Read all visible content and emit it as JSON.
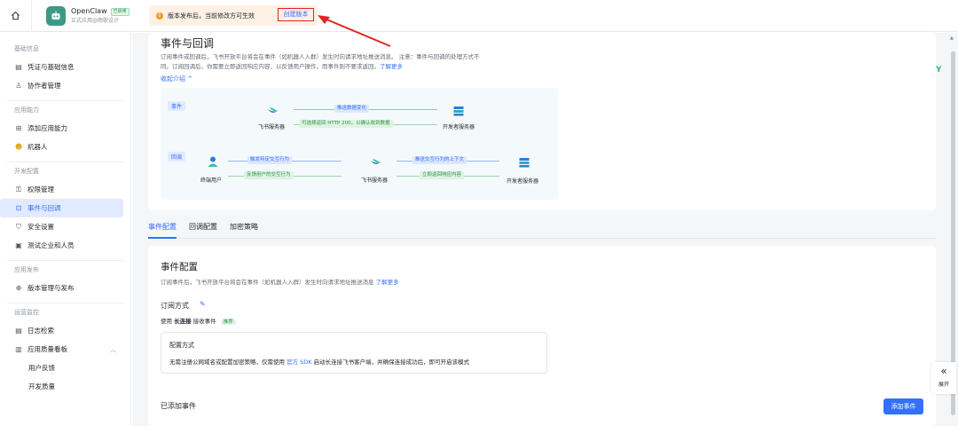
{
  "topbar": {
    "app_name": "OpenClaw",
    "enabled_badge": "已启用",
    "app_sub": "正式应用@雨歌设计",
    "notice_text": "版本发布后，当前修改方可生效",
    "create_version": "创建版本"
  },
  "sidebar": {
    "sections": [
      {
        "title": "基础信息",
        "items": [
          {
            "label": "凭证与基础信息",
            "icon": "credential-icon"
          },
          {
            "label": "协作者管理",
            "icon": "user-icon"
          }
        ]
      },
      {
        "title": "应用能力",
        "items": [
          {
            "label": "添加应用能力",
            "icon": "grid-add-icon"
          },
          {
            "label": "机器人",
            "icon": "robot-icon"
          }
        ]
      },
      {
        "title": "开发配置",
        "items": [
          {
            "label": "权限管理",
            "icon": "lock-icon"
          },
          {
            "label": "事件与回调",
            "icon": "event-icon",
            "active": true
          },
          {
            "label": "安全设置",
            "icon": "shield-icon"
          },
          {
            "label": "测试企业和人员",
            "icon": "test-icon"
          }
        ]
      },
      {
        "title": "应用发布",
        "items": [
          {
            "label": "版本管理与发布",
            "icon": "version-icon"
          }
        ]
      },
      {
        "title": "运营监控",
        "items": [
          {
            "label": "日志检索",
            "icon": "log-icon"
          },
          {
            "label": "应用质量看板",
            "icon": "chart-icon"
          }
        ]
      }
    ],
    "sub_items": [
      "用户反馈",
      "开发质量"
    ]
  },
  "card1": {
    "title": "事件与回调",
    "desc1": "订阅事件或回调后，飞书开放平台将会在事件（如机器人入群）发生时向请求地址推送消息。 注意：事件与回调的处理方式不",
    "desc2": "同。订阅回调后，你需要立即返回响应内容，以反馈用户操作，而事件则不要求返回。",
    "learn_more": "了解更多",
    "collapse": "收起介绍 ^",
    "diagram": {
      "event_tag": "事件",
      "callback_tag": "回调",
      "feishu_server": "飞书服务器",
      "dev_server": "开发者服务器",
      "end_user": "终端用户",
      "push_data": "推送数据变化",
      "http_ok": "可选择返回 HTTP 200，以确认收到数据",
      "trigger": "触发特定交互行为",
      "feedback": "反馈用户的交互行为",
      "push_ctx": "推送交互行为的上下文",
      "return_resp": "立即返回响应内容"
    }
  },
  "tabs": [
    "事件配置",
    "回调配置",
    "加密策略"
  ],
  "card2": {
    "title": "事件配置",
    "desc": "订阅事件后，飞书开放平台将会在事件（如机器人入群）发生时向请求地址推送消息",
    "learn_more": "了解更多",
    "sub_title": "订阅方式",
    "use_prefix": "使用",
    "use_bold": "长连接",
    "use_suffix": "接收事件",
    "recommend": "推荐",
    "cfg_title": "配置方式",
    "cfg_text_a": "无需注册公网域名或配置加密策略，仅需使用",
    "cfg_link": "官方 SDK",
    "cfg_text_b": "启动长连接飞书客户端，并确保连接成功后，即可开启该模式",
    "added_title": "已添加事件",
    "add_button": "添加事件"
  },
  "expand_label": "展开",
  "colors": {
    "accent": "#3370ff",
    "annotation": "#e02424"
  }
}
